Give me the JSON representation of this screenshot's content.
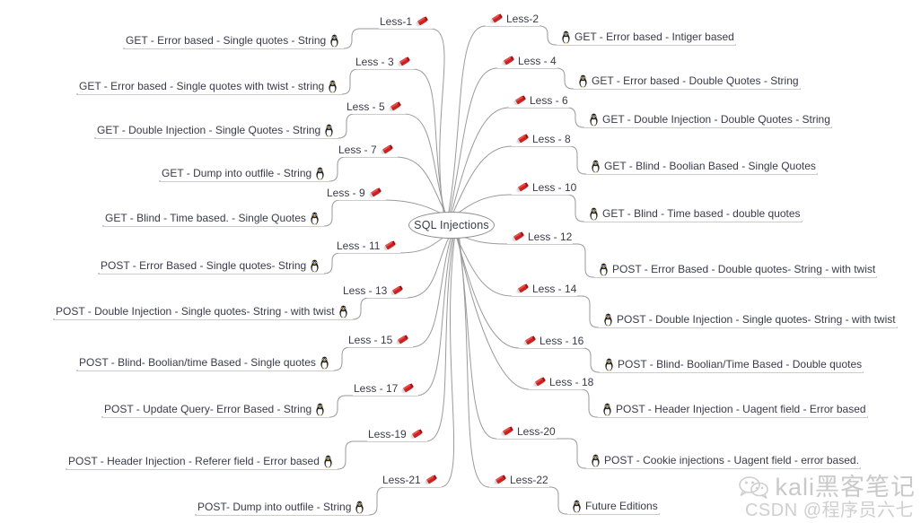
{
  "root": {
    "label": "SQL Injections"
  },
  "icons": {
    "pen": "red-marker-pen-icon",
    "tux": "linux-tux-penguin-icon",
    "wechat": "wechat-logo-icon"
  },
  "watermark": {
    "line1": "kali黑客笔记",
    "line2": "CSDN @程序员六七"
  },
  "left_branches": [
    {
      "lesson": "Less-1",
      "topic": "GET - Error based - Single quotes - String"
    },
    {
      "lesson": "Less - 3",
      "topic": "GET - Error based - Single quotes with twist - string"
    },
    {
      "lesson": "Less - 5",
      "topic": "GET - Double Injection - Single Quotes - String"
    },
    {
      "lesson": "Less - 7",
      "topic": "GET - Dump into outfile - String"
    },
    {
      "lesson": "Less - 9",
      "topic": "GET - Blind - Time based. -  Single Quotes"
    },
    {
      "lesson": "Less - 11",
      "topic": "POST - Error Based - Single quotes- String"
    },
    {
      "lesson": "Less - 13",
      "topic": "POST - Double Injection - Single quotes- String - with twist"
    },
    {
      "lesson": "Less - 15",
      "topic": "POST - Blind- Boolian/time Based - Single quotes"
    },
    {
      "lesson": "Less - 17",
      "topic": "POST - Update Query- Error Based - String"
    },
    {
      "lesson": "Less-19",
      "topic": "POST - Header Injection - Referer field - Error based"
    },
    {
      "lesson": "Less-21",
      "topic": "POST- Dump into outfile - String"
    }
  ],
  "right_branches": [
    {
      "lesson": "Less-2",
      "topic": "GET - Error based - Intiger based"
    },
    {
      "lesson": "Less - 4",
      "topic": "GET - Error based - Double Quotes - String"
    },
    {
      "lesson": "Less - 6",
      "topic": "GET - Double Injection - Double Quotes - String"
    },
    {
      "lesson": "Less - 8",
      "topic": "GET - Blind - Boolian Based - Single Quotes"
    },
    {
      "lesson": "Less - 10",
      "topic": "GET - Blind - Time based - double quotes"
    },
    {
      "lesson": "Less - 12",
      "topic": "POST - Error Based - Double quotes- String - with twist"
    },
    {
      "lesson": "Less - 14",
      "topic": "POST - Double Injection - Single quotes- String - with twist"
    },
    {
      "lesson": "Less - 16",
      "topic": "POST - Blind- Boolian/Time Based - Double quotes"
    },
    {
      "lesson": "Less - 18",
      "topic": "POST - Header Injection - Uagent field - Error based"
    },
    {
      "lesson": "Less-20",
      "topic": "POST - Cookie injections - Uagent field - error based."
    },
    {
      "lesson": "Less-22",
      "topic": "Future Editions"
    }
  ],
  "colors": {
    "line": "#9a9a9a",
    "text": "#3a3a4a",
    "pen_body": "#cc2222",
    "background": "#ffffff",
    "watermark": "#c9c9c9"
  }
}
